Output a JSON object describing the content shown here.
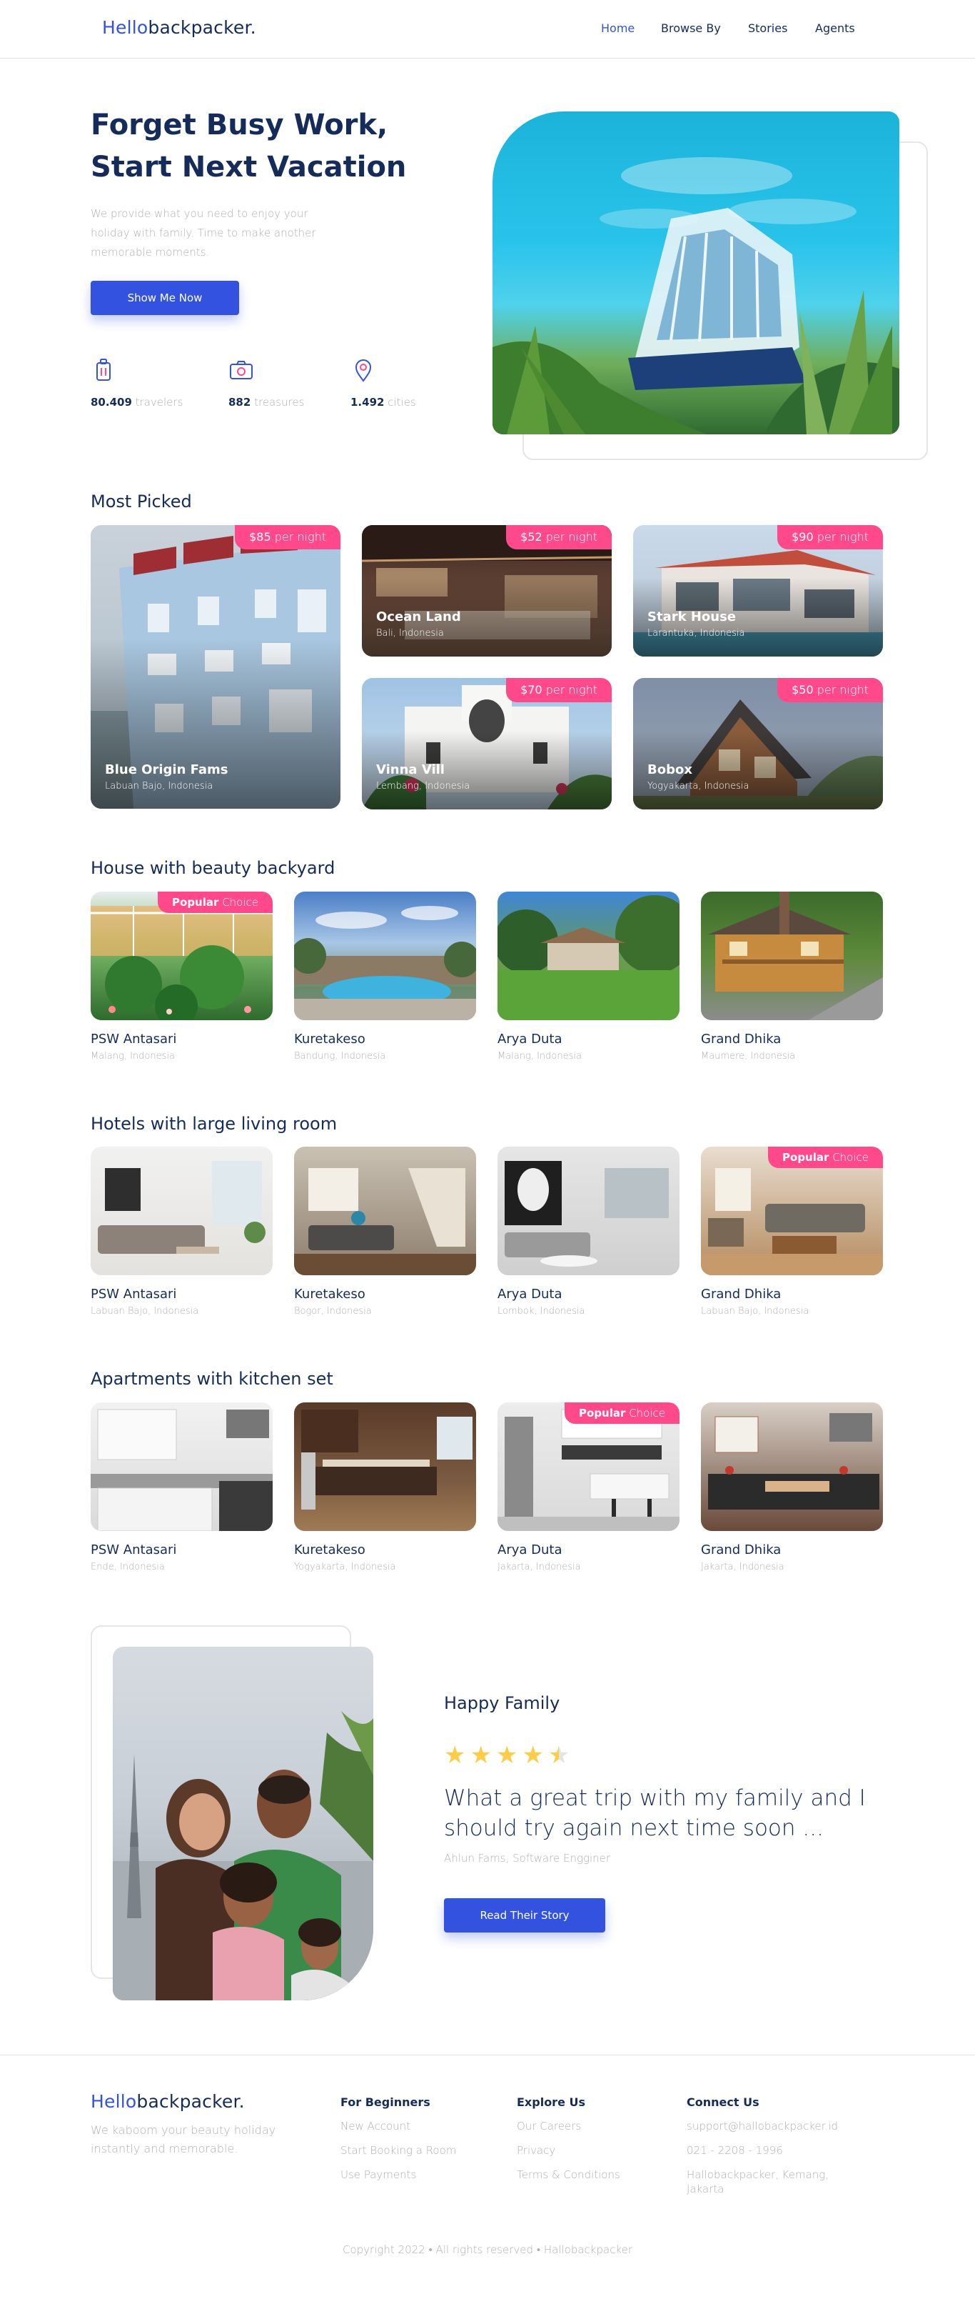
{
  "header": {
    "logo_highlight": "Hello",
    "logo_rest": "backpacker.",
    "nav": [
      "Home",
      "Browse By",
      "Stories",
      "Agents"
    ]
  },
  "hero": {
    "title_line1": "Forget Busy Work,",
    "title_line2": "Start Next Vacation",
    "description": "We provide what you need to enjoy your holiday with family. Time to make another memorable moments.",
    "cta": "Show Me Now",
    "stats": [
      {
        "icon": "traveler-icon",
        "value": "80.409",
        "label": "travelers"
      },
      {
        "icon": "treasure-icon",
        "value": "882",
        "label": "treasures"
      },
      {
        "icon": "city-icon",
        "value": "1.492",
        "label": "cities"
      }
    ]
  },
  "most_picked": {
    "title": "Most Picked",
    "items": [
      {
        "name": "Blue Origin Fams",
        "location": "Labuan Bajo, Indonesia",
        "price": "$85",
        "unit": "per night"
      },
      {
        "name": "Ocean Land",
        "location": "Bali, Indonesia",
        "price": "$52",
        "unit": "per night"
      },
      {
        "name": "Stark House",
        "location": "Larantuka, Indonesia",
        "price": "$90",
        "unit": "per night"
      },
      {
        "name": "Vinna Vill",
        "location": "Lembang, Indonesia",
        "price": "$70",
        "unit": "per night"
      },
      {
        "name": "Bobox",
        "location": "Yogyakarta, Indonesia",
        "price": "$50",
        "unit": "per night"
      }
    ]
  },
  "categories": [
    {
      "title": "House with beauty backyard",
      "items": [
        {
          "name": "PSW Antasari",
          "location": "Malang, Indonesia"
        },
        {
          "name": "Kuretakeso",
          "location": "Bandung, Indonesia"
        },
        {
          "name": "Arya Duta",
          "location": "Malang, Indonesia"
        },
        {
          "name": "Grand Dhika",
          "location": "Maumere, Indonesia"
        }
      ]
    },
    {
      "title": "Hotels with large living room",
      "items": [
        {
          "name": "PSW Antasari",
          "location": "Labuan Bajo, Indonesia"
        },
        {
          "name": "Kuretakeso",
          "location": "Bogor, Indonesia"
        },
        {
          "name": "Arya Duta",
          "location": "Lombok, Indonesia"
        },
        {
          "name": "Grand Dhika",
          "location": "Labuan Bajo, Indonesia"
        }
      ]
    },
    {
      "title": "Apartments with kitchen set",
      "items": [
        {
          "name": "PSW Antasari",
          "location": "Ende, Indonesia"
        },
        {
          "name": "Kuretakeso",
          "location": "Yogyakarta, Indonesia"
        },
        {
          "name": "Arya Duta",
          "location": "Jakarta, Indonesia"
        },
        {
          "name": "Grand Dhika",
          "location": "Jakarta, Indonesia"
        }
      ]
    }
  ],
  "popular_badge": {
    "strong": "Popular",
    "light": "Choice"
  },
  "testimonial": {
    "title": "Happy Family",
    "rating": 4.5,
    "quote": "What a great trip with my family and I should try again next time soon ...",
    "author": "Ahlun Fams, Software Engginer",
    "cta": "Read Their Story"
  },
  "footer": {
    "tagline": "We kaboom your beauty holiday instantly and memorable.",
    "columns": [
      {
        "title": "For Beginners",
        "links": [
          "New Account",
          "Start Booking a Room",
          "Use Payments"
        ]
      },
      {
        "title": "Explore Us",
        "links": [
          "Our Careers",
          "Privacy",
          "Terms & Conditions"
        ]
      },
      {
        "title": "Connect Us",
        "links": [
          "support@hallobackpacker.id",
          "021 - 2208 - 1996",
          "Hallobackpacker, Kemang, Jakarta"
        ]
      }
    ],
    "copyright": "Copyright 2022 • All rights reserved • Hallobackpacker"
  },
  "colors": {
    "primary": "#3252DF",
    "navy": "#152C5B",
    "pink": "#FF498B",
    "gray": "#B0B0B0",
    "star": "#FFCC47"
  }
}
